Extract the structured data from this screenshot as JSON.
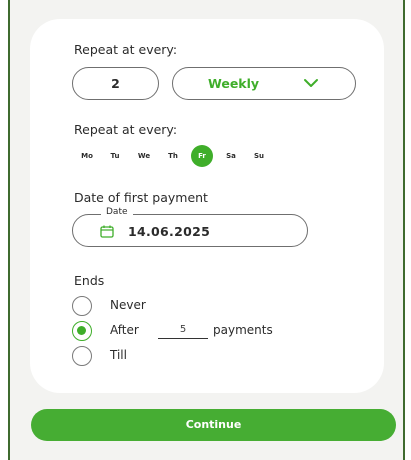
{
  "repeat": {
    "label": "Repeat at every:",
    "interval_value": "2",
    "frequency": "Weekly",
    "accent_color": "#3fae2a"
  },
  "weekdays": {
    "label": "Repeat at every:",
    "days": [
      "Mo",
      "Tu",
      "We",
      "Th",
      "Fr",
      "Sa",
      "Su"
    ],
    "selected": "Fr"
  },
  "first_payment": {
    "label": "Date of first payment",
    "field_label": "Date",
    "value": "14.06.2025",
    "icon": "calendar-icon"
  },
  "ends": {
    "label": "Ends",
    "options": {
      "never": "Never",
      "after_prefix": "After",
      "after_value": "5",
      "after_suffix": "payments",
      "till": "Till"
    },
    "selected": "after"
  },
  "continue_label": "Continue"
}
